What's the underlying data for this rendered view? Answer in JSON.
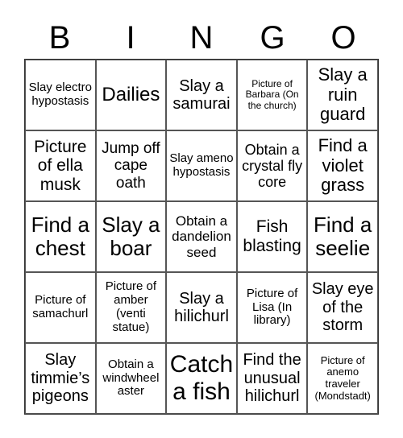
{
  "header": [
    "B",
    "I",
    "N",
    "G",
    "O"
  ],
  "cells": [
    "Slay electro hypostasis",
    "Dailies",
    "Slay a samurai",
    "Picture of Barbara (On the church)",
    "Slay a ruin guard",
    "Picture of ella musk",
    "Jump off cape oath",
    "Slay ameno hypostasis",
    "Obtain a crystal fly core",
    "Find a violet grass",
    "Find a chest",
    "Slay a boar",
    "Obtain a dandelion seed",
    "Fish blasting",
    "Find a seelie",
    "Picture of samachurl",
    "Picture of amber (venti statue)",
    "Slay a hilichurl",
    "Picture of Lisa (In library)",
    "Slay eye of the storm",
    "Slay timmie’s pigeons",
    "Obtain a windwheel aster",
    "Catch a fish",
    "Find the unusual hilichurl",
    "Picture of anemo traveler (Mondstadt)"
  ]
}
